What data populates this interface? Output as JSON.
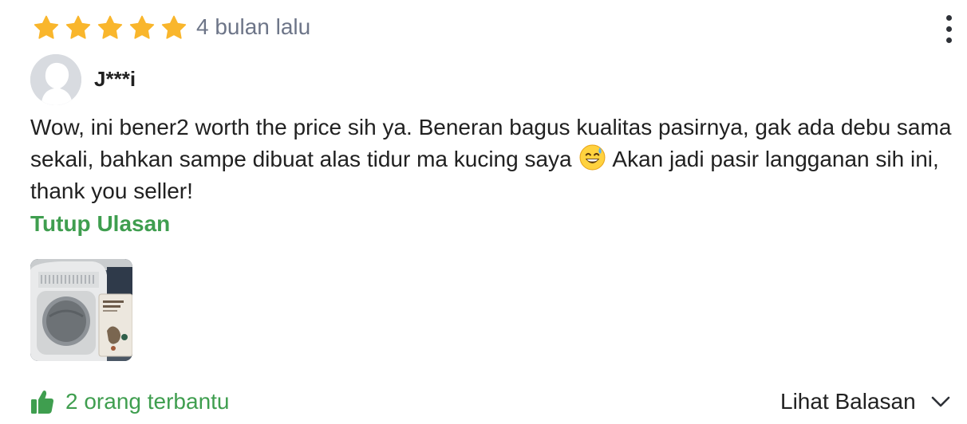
{
  "review": {
    "rating": 5,
    "time_ago": "4 bulan lalu",
    "reviewer_name": "J***i",
    "text_before_emoji": "Wow, ini bener2 worth the price sih ya. Beneran bagus kualitas pasirnya, gak ada debu sama sekali, bahkan sampe dibuat alas tidur ma kucing saya ",
    "emoji": "grinning-face-with-sweat-emoji",
    "text_after_emoji": "Akan jadi pasir langganan sih ini, thank you seller!",
    "toggle_label": "Tutup Ulasan",
    "photo": "litter-box-photo"
  },
  "footer": {
    "helpful_label": "2 orang terbantu",
    "replies_label": "Lihat Balasan"
  },
  "icons": {
    "star": "star-icon",
    "more": "more-vertical-icon",
    "thumb": "thumbs-up-icon",
    "chevron": "chevron-down-icon"
  },
  "colors": {
    "star": "#f9b62c",
    "brand_green": "#3f9e4f",
    "muted_text": "#6d7588"
  }
}
